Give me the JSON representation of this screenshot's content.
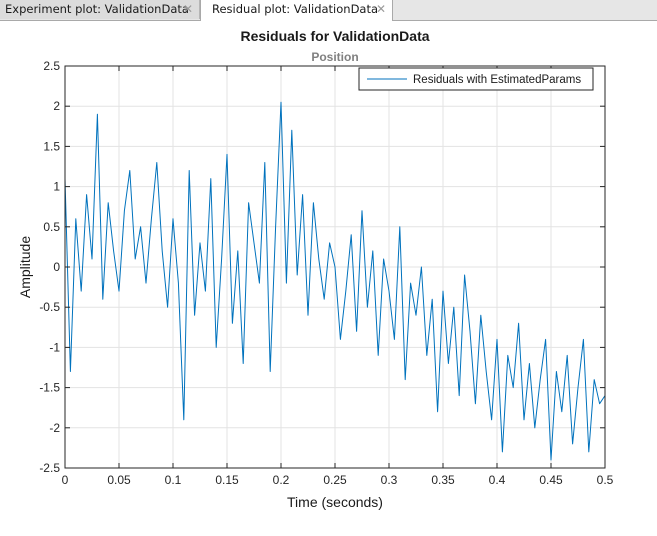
{
  "tabs": [
    {
      "label": "Experiment plot: ValidationData",
      "close_icon": "close-icon"
    },
    {
      "label": "Residual plot: ValidationData",
      "close_icon": "close-icon"
    }
  ],
  "colors": {
    "series": "#0072bd",
    "grid": "#e3e3e3",
    "axis": "#262626",
    "subtitle": "#808080"
  },
  "chart_data": {
    "type": "line",
    "title": "Residuals for ValidationData",
    "subtitle": "Position",
    "xlabel": "Time (seconds)",
    "ylabel": "Amplitude",
    "xlim": [
      0,
      0.5
    ],
    "ylim": [
      -2.5,
      2.5
    ],
    "xticks": [
      "0",
      "0.05",
      "0.1",
      "0.15",
      "0.2",
      "0.25",
      "0.3",
      "0.35",
      "0.4",
      "0.45",
      "0.5"
    ],
    "yticks": [
      "2.5",
      "2",
      "1.5",
      "1",
      "0.5",
      "0",
      "-0.5",
      "-1",
      "-1.5",
      "-2",
      "-2.5"
    ],
    "grid": true,
    "legend_position": "top-right",
    "series": [
      {
        "name": "Residuals with EstimatedParams",
        "color": "#0072bd",
        "x": [
          0,
          0.005,
          0.01,
          0.015,
          0.02,
          0.025,
          0.03,
          0.035,
          0.04,
          0.045,
          0.05,
          0.055,
          0.06,
          0.065,
          0.07,
          0.075,
          0.08,
          0.085,
          0.09,
          0.095,
          0.1,
          0.105,
          0.11,
          0.115,
          0.12,
          0.125,
          0.13,
          0.135,
          0.14,
          0.145,
          0.15,
          0.155,
          0.16,
          0.165,
          0.17,
          0.175,
          0.18,
          0.185,
          0.19,
          0.195,
          0.2,
          0.205,
          0.21,
          0.215,
          0.22,
          0.225,
          0.23,
          0.235,
          0.24,
          0.245,
          0.25,
          0.255,
          0.26,
          0.265,
          0.27,
          0.275,
          0.28,
          0.285,
          0.29,
          0.295,
          0.3,
          0.305,
          0.31,
          0.315,
          0.32,
          0.325,
          0.33,
          0.335,
          0.34,
          0.345,
          0.35,
          0.355,
          0.36,
          0.365,
          0.37,
          0.375,
          0.38,
          0.385,
          0.39,
          0.395,
          0.4,
          0.405,
          0.41,
          0.415,
          0.42,
          0.425,
          0.43,
          0.435,
          0.44,
          0.445,
          0.45,
          0.455,
          0.46,
          0.465,
          0.47,
          0.475,
          0.48,
          0.485,
          0.49,
          0.495,
          0.5
        ],
        "y": [
          1.1,
          -1.3,
          0.6,
          -0.3,
          0.9,
          0.1,
          1.9,
          -0.4,
          0.8,
          0.2,
          -0.3,
          0.7,
          1.2,
          0.1,
          0.5,
          -0.2,
          0.6,
          1.3,
          0.2,
          -0.5,
          0.6,
          -0.2,
          -1.9,
          1.2,
          -0.6,
          0.3,
          -0.3,
          1.1,
          -1.0,
          0.1,
          1.4,
          -0.7,
          0.2,
          -1.2,
          0.8,
          0.3,
          -0.2,
          1.3,
          -1.3,
          0.5,
          2.05,
          -0.2,
          1.7,
          -0.1,
          0.9,
          -0.6,
          0.8,
          0.1,
          -0.4,
          0.3,
          0.0,
          -0.9,
          -0.3,
          0.4,
          -0.8,
          0.7,
          -0.5,
          0.2,
          -1.1,
          0.1,
          -0.3,
          -0.9,
          0.5,
          -1.4,
          -0.2,
          -0.6,
          0.0,
          -1.1,
          -0.4,
          -1.8,
          -0.3,
          -1.2,
          -0.5,
          -1.6,
          -0.1,
          -0.8,
          -1.7,
          -0.6,
          -1.3,
          -1.9,
          -0.9,
          -2.3,
          -1.1,
          -1.5,
          -0.7,
          -1.9,
          -1.2,
          -2.0,
          -1.4,
          -0.9,
          -2.4,
          -1.3,
          -1.8,
          -1.1,
          -2.2,
          -1.5,
          -0.9,
          -2.3,
          -1.4,
          -1.7,
          -1.6
        ]
      }
    ]
  }
}
